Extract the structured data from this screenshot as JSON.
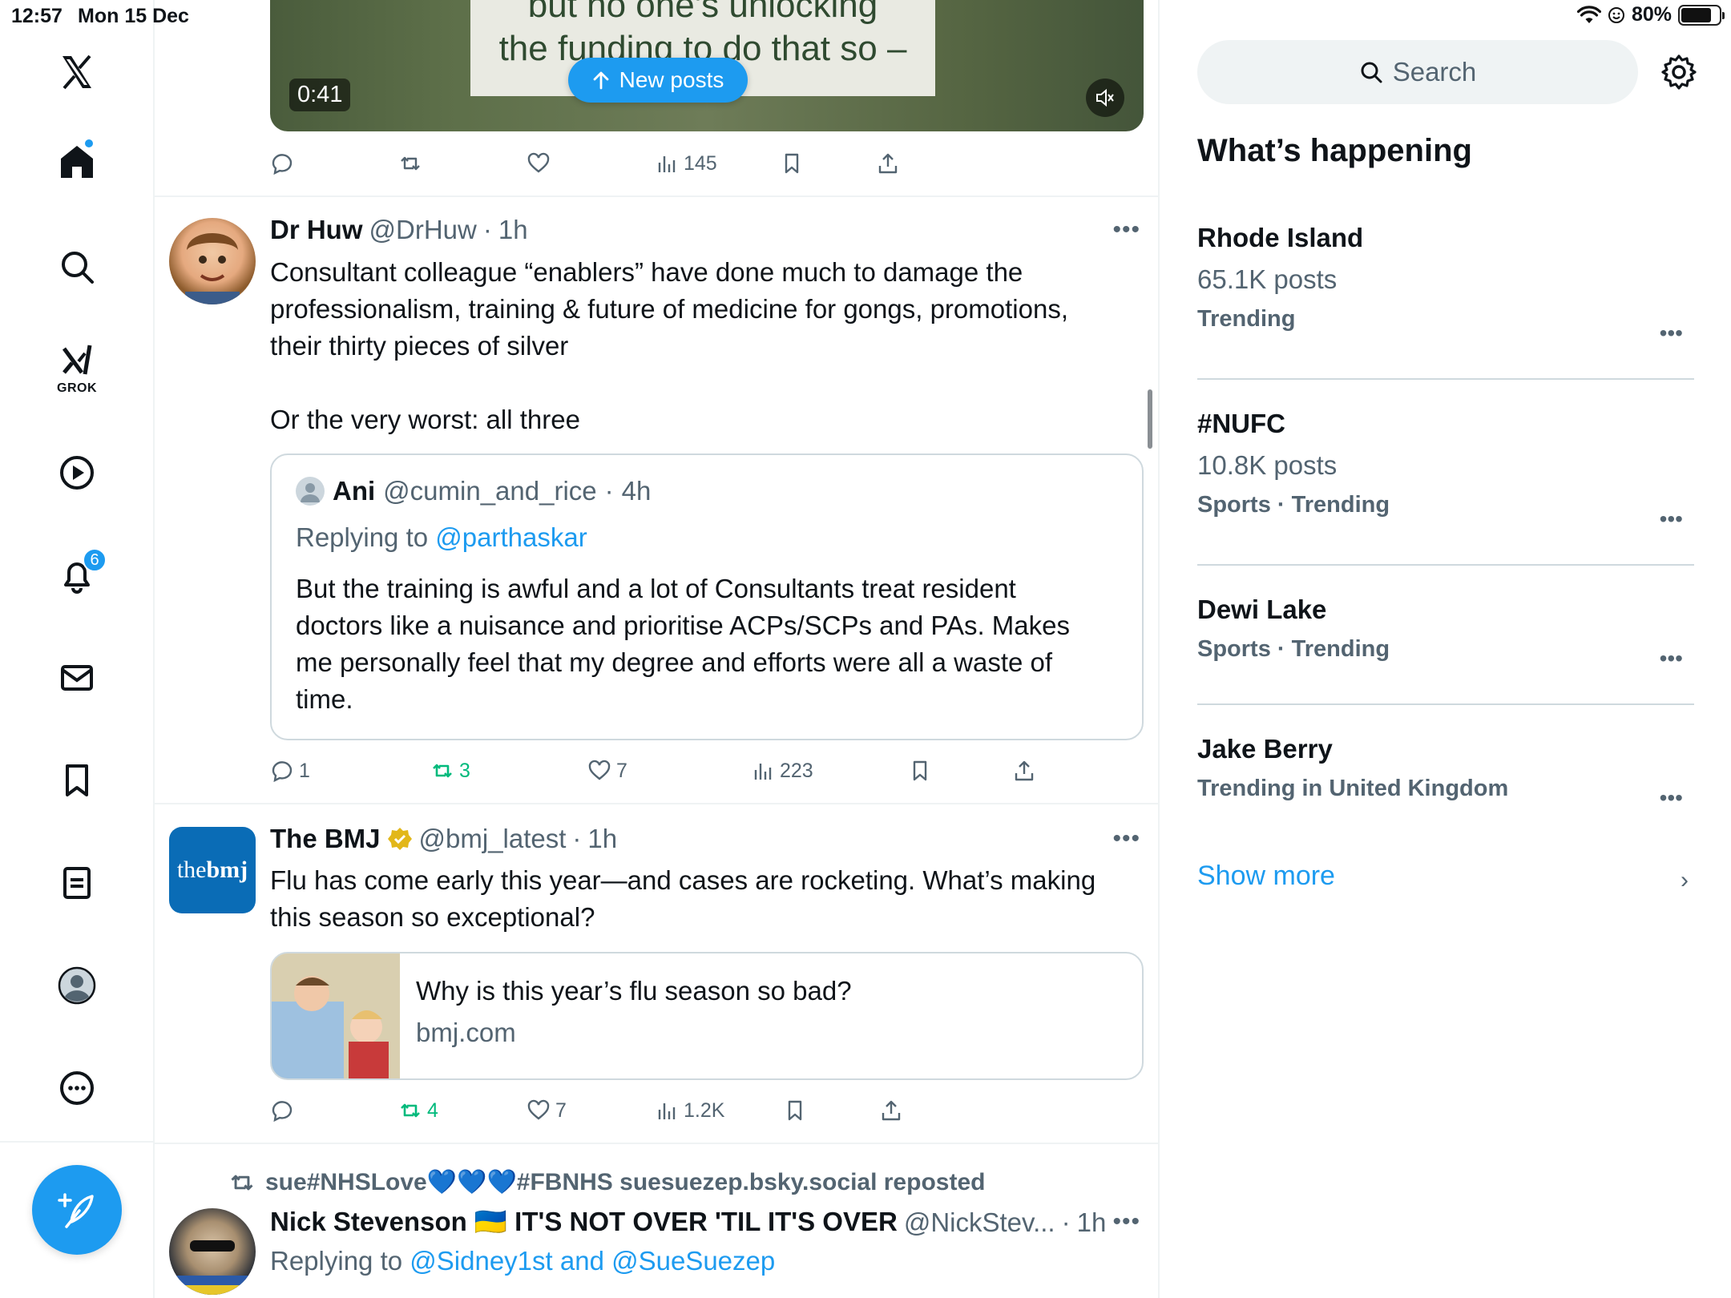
{
  "status": {
    "time": "12:57",
    "date": "Mon 15 Dec",
    "battery": "80%",
    "battery_level": 0.8
  },
  "nav": {
    "notifications_badge": "6",
    "grok_label": "GROK"
  },
  "top_post": {
    "caption_line1": "but no one's unlocking",
    "caption_line2": "the funding to do that so –",
    "video_time": "0:41",
    "new_posts": "New posts",
    "views": "145"
  },
  "tweet1": {
    "name": "Dr Huw",
    "handle": "@DrHuw",
    "time": "1h",
    "text_line1": "Consultant colleague “enablers” have done much to damage the",
    "text_line2": "professionalism, training & future of medicine for gongs, promotions,",
    "text_line3": "their thirty pieces of silver",
    "text_line4": "Or the very worst: all three",
    "quote": {
      "name": "Ani",
      "handle": "@cumin_and_rice",
      "time": "4h",
      "replying_prefix": "Replying to",
      "replying_to": "@parthaskar",
      "line1": "But the training is awful and a lot of Consultants treat resident",
      "line2": "doctors like a nuisance and prioritise ACPs/SCPs and PAs. Makes",
      "line3": "me personally feel that my degree and efforts were all a waste of",
      "line4": "time."
    },
    "replies": "1",
    "reposts": "3",
    "likes": "7",
    "views": "223"
  },
  "tweet2": {
    "name": "The BMJ",
    "handle": "@bmj_latest",
    "time": "1h",
    "avatar_text_a": "the",
    "avatar_text_b": "bmj",
    "text_line1": "Flu has come early this year—and cases are rocketing. What’s making",
    "text_line2": "this season so exceptional?",
    "card_title": "Why is this year’s flu season so bad?",
    "card_domain": "bmj.com",
    "reposts": "4",
    "likes": "7",
    "views": "1.2K"
  },
  "tweet3": {
    "reposted_by": "sue#NHSLove💙💙💙#FBNHS suesuezep.bsky.social reposted",
    "name": "Nick Stevenson 🇺🇦 IT'S NOT OVER 'TIL IT'S OVER",
    "handle": "@NickStev...",
    "time": "1h",
    "replying_prefix": "Replying to",
    "replying_to": "@Sidney1st and @SueSuezep"
  },
  "sidebar": {
    "search_placeholder": "Search",
    "heading": "What’s happening",
    "trends": [
      {
        "name": "Rhode Island",
        "posts": "65.1K posts",
        "meta": "Trending"
      },
      {
        "name": "#NUFC",
        "posts": "10.8K posts",
        "meta": "Sports · Trending"
      },
      {
        "name": "Dewi Lake",
        "posts": "",
        "meta": "Sports · Trending"
      },
      {
        "name": "Jake Berry",
        "posts": "",
        "meta": "Trending in United Kingdom"
      }
    ],
    "show_more": "Show more"
  },
  "colors": {
    "accent": "#1d9bf0",
    "text": "#0f1419",
    "muted": "#536471",
    "repost_green": "#00ba7c"
  }
}
